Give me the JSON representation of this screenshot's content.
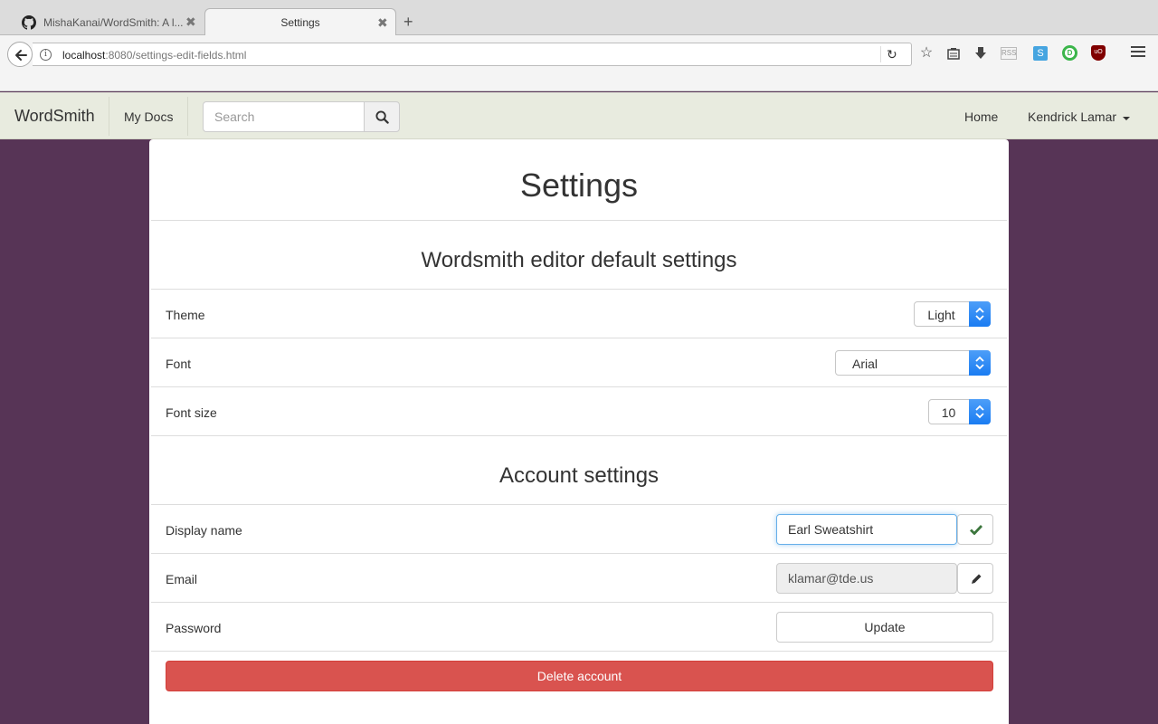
{
  "browser": {
    "tabs": [
      {
        "title": "MishaKanai/WordSmith: A l...",
        "active": false
      },
      {
        "title": "Settings",
        "active": true
      }
    ],
    "url": {
      "host": "localhost",
      "rest": ":8080/settings-edit-fields.html"
    },
    "toolbar_icons": [
      "bookmark-star-icon",
      "reading-list-icon",
      "download-icon",
      "rss-icon",
      "s-extension-icon",
      "d-extension-icon",
      "ublock-icon"
    ],
    "rss_label": "RSS",
    "s_label": "S",
    "d_label": "D",
    "ub_label": "uO"
  },
  "navbar": {
    "brand": "WordSmith",
    "my_docs": "My Docs",
    "search_placeholder": "Search",
    "home": "Home",
    "user": "Kendrick Lamar"
  },
  "page": {
    "title": "Settings",
    "editor_section": {
      "title": "Wordsmith editor default settings",
      "theme": {
        "label": "Theme",
        "value": "Light"
      },
      "font": {
        "label": "Font",
        "value": "Arial"
      },
      "font_size": {
        "label": "Font size",
        "value": "10"
      }
    },
    "account_section": {
      "title": "Account settings",
      "display_name": {
        "label": "Display name",
        "value": "Earl Sweatshirt"
      },
      "email": {
        "label": "Email",
        "value": "klamar@tde.us"
      },
      "password": {
        "label": "Password",
        "button": "Update"
      },
      "delete_button": "Delete account"
    }
  },
  "colors": {
    "page_background": "#573456",
    "navbar_background": "#e8ebdf",
    "danger": "#d9534f",
    "select_accent": "#1a7cf2",
    "success_check": "#3c763d"
  }
}
